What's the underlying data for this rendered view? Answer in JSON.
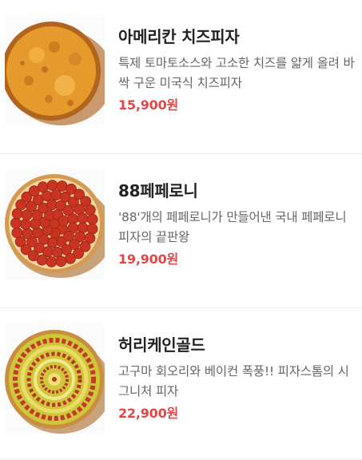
{
  "menu": {
    "items": [
      {
        "name": "아메리칸 치즈피자",
        "description": "특제 토마토소스와 고소한 치즈를 얇게 올려 바싹 구운 미국식 치즈피자",
        "price": "15,900원",
        "image_icon": "cheese-pizza-image"
      },
      {
        "name": "88페페로니",
        "description": "'88'개의 페페로니가 만들어낸 국내 페페로니 피자의 끝판왕",
        "price": "19,900원",
        "image_icon": "pepperoni-pizza-image"
      },
      {
        "name": "허리케인골드",
        "description": "고구마 회오리와 베이컨 폭풍!! 피자스톰의 시그니처 피자",
        "price": "22,900원",
        "image_icon": "hurricane-gold-pizza-image"
      }
    ]
  },
  "colors": {
    "price": "#e04848",
    "name": "#222222",
    "description": "#666666",
    "divider": "#ececec"
  }
}
